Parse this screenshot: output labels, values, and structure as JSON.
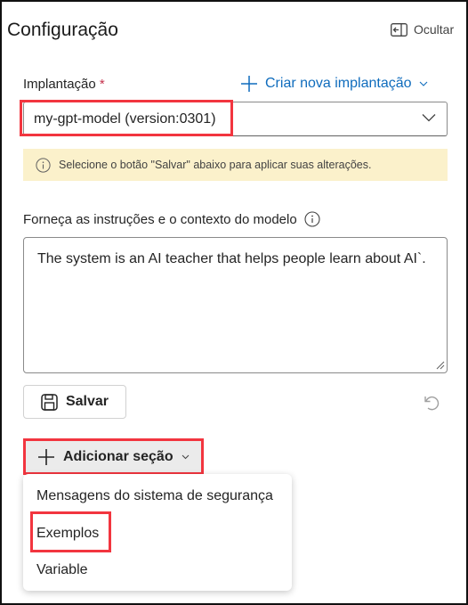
{
  "header": {
    "title": "Configuração",
    "hide_label": "Ocultar"
  },
  "deployment": {
    "label": "Implantação",
    "required_mark": "*",
    "create_label": "Criar nova implantação",
    "selected": "my-gpt-model (version:0301)"
  },
  "info_bar": {
    "text": "Selecione o botão \"Salvar\" abaixo para aplicar suas alterações."
  },
  "instructions": {
    "label": "Forneça as instruções e o contexto do modelo",
    "value": "The system is an AI teacher that helps people learn about AI`."
  },
  "actions": {
    "save_label": "Salvar",
    "add_section_label": "Adicionar seção"
  },
  "menu": {
    "items": [
      {
        "label": "Mensagens do sistema de segurança"
      },
      {
        "label": "Exemplos"
      },
      {
        "label": "Variable"
      }
    ]
  },
  "colors": {
    "accent": "#0f6cbd",
    "highlight": "#f2353f",
    "info_bg": "#fbf1cb"
  }
}
